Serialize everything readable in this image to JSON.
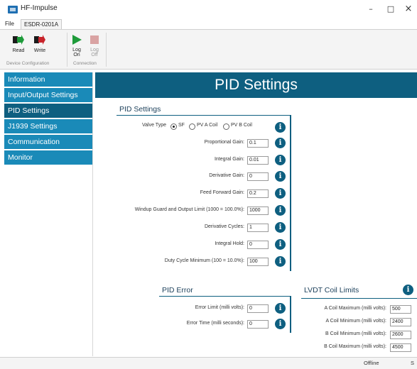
{
  "window": {
    "title": "HF-Impulse",
    "minimize": "–",
    "maximize": "□",
    "close": "×"
  },
  "ribbon": {
    "tabs": [
      {
        "label": "File"
      },
      {
        "label": "ESDR-0201A"
      }
    ],
    "buttons": {
      "read": "Read",
      "write": "Write",
      "log_on": "Log\nOn",
      "log_off": "Log\nOff"
    },
    "groups": {
      "device_config": "Device Configuration",
      "connection": "Connection"
    }
  },
  "sidebar": {
    "items": [
      {
        "label": "Information"
      },
      {
        "label": "Input/Output Settings"
      },
      {
        "label": "PID Settings"
      },
      {
        "label": "J1939 Settings"
      },
      {
        "label": "Communication"
      },
      {
        "label": "Monitor"
      }
    ]
  },
  "main": {
    "title": "PID Settings",
    "pid": {
      "group_title": "PID Settings",
      "valve_type_label": "Valve Type",
      "valve_options": [
        "SF",
        "PV A Coil",
        "PV B Coil"
      ],
      "valve_selected": "SF",
      "fields": [
        {
          "label": "Proportional Gain:",
          "value": "0.1"
        },
        {
          "label": "Integral Gain:",
          "value": "0.01"
        },
        {
          "label": "Derivative Gain:",
          "value": "0"
        },
        {
          "label": "Feed Forward Gain:",
          "value": "0.2"
        },
        {
          "label": "Windup Guard and Output Limit (1000 = 100.0%):",
          "value": "1000"
        },
        {
          "label": "Derivative Cycles:",
          "value": "1"
        },
        {
          "label": "Integral Hold:",
          "value": "0"
        },
        {
          "label": "Duty Cycle Minimum (100 = 10.0%):",
          "value": "100"
        }
      ]
    },
    "pid_error": {
      "group_title": "PID Error",
      "fields": [
        {
          "label": "Error Limit (milli volts):",
          "value": "0"
        },
        {
          "label": "Error Time (milli seconds):",
          "value": "0"
        }
      ]
    },
    "lvdt": {
      "group_title": "LVDT Coil Limits",
      "fields": [
        {
          "label": "A Coil Maximum (milli volts):",
          "value": "500"
        },
        {
          "label": "A Coil Minimum (milli volts):",
          "value": "2400"
        },
        {
          "label": "B Coil Minimum (milli volts):",
          "value": "2600"
        },
        {
          "label": "B Coil Maximum (milli volts):",
          "value": "4500"
        }
      ]
    },
    "info_glyph": "i"
  },
  "status": {
    "text": "Offline",
    "extra": "S"
  },
  "colors": {
    "nav": "#1a8ab8",
    "nav_selected": "#0e5f80",
    "header": "#0e5f80",
    "read_icon": "#1e9b3a",
    "write_icon": "#c8242b",
    "log_on_icon": "#1e9b3a",
    "log_off_icon": "#d9a3a3"
  }
}
